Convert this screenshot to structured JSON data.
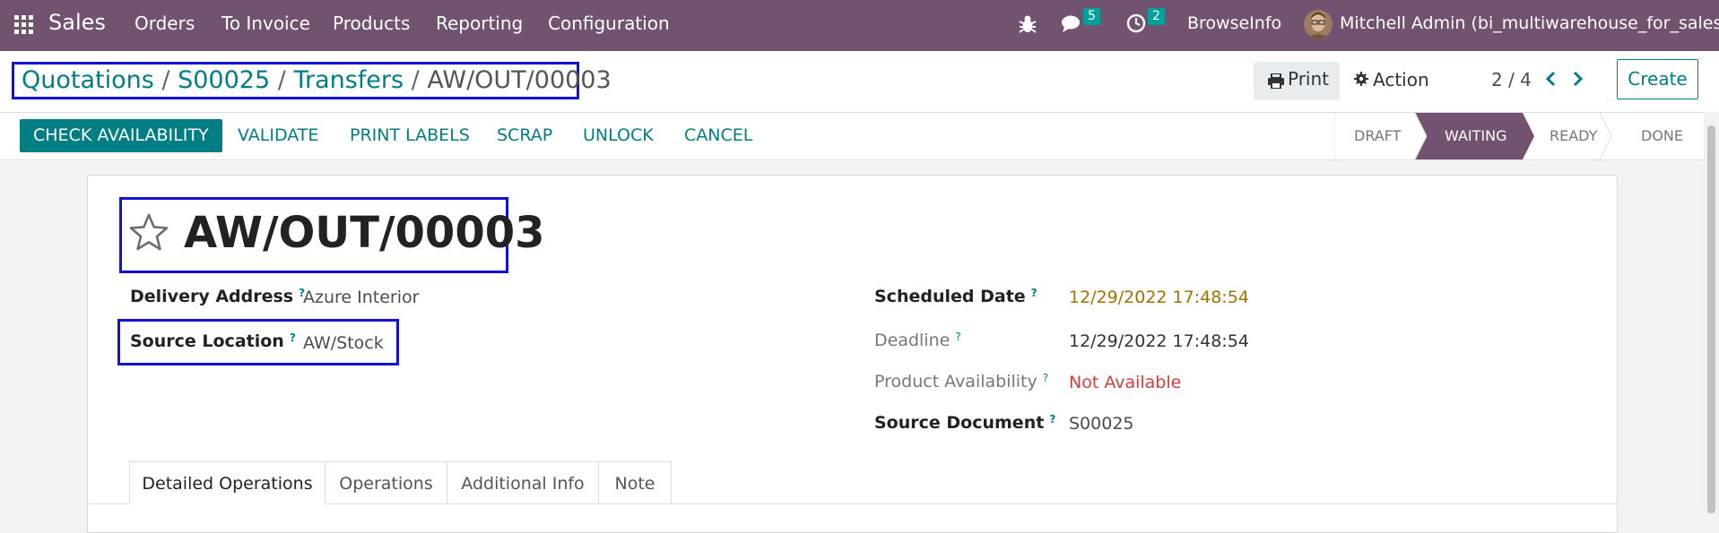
{
  "navbar": {
    "app_name": "Sales",
    "menu": [
      "Orders",
      "To Invoice",
      "Products",
      "Reporting",
      "Configuration"
    ],
    "messages_count": "5",
    "activities_count": "2",
    "company": "BrowseInfo",
    "user": "Mitchell Admin (bi_multiwarehouse_for_sales)"
  },
  "breadcrumb": {
    "items": [
      "Quotations",
      "S00025",
      "Transfers"
    ],
    "separator": "/",
    "current": "AW/OUT/00003"
  },
  "control": {
    "print_label": "Print",
    "action_label": "Action",
    "pager": "2 / 4",
    "create_label": "Create"
  },
  "statusbar": {
    "buttons": [
      "CHECK AVAILABILITY",
      "VALIDATE",
      "PRINT LABELS",
      "SCRAP",
      "UNLOCK",
      "CANCEL"
    ],
    "stages": [
      "DRAFT",
      "WAITING",
      "READY",
      "DONE"
    ],
    "active_stage": "WAITING"
  },
  "form": {
    "title": "AW/OUT/00003",
    "help_mark": "?",
    "delivery_address_label": "Delivery Address",
    "delivery_address": "Azure Interior",
    "source_location_label": "Source Location",
    "source_location": "AW/Stock",
    "scheduled_date_label": "Scheduled Date",
    "scheduled_date": "12/29/2022 17:48:54",
    "deadline_label": "Deadline",
    "deadline": "12/29/2022 17:48:54",
    "availability_label": "Product Availability",
    "availability": "Not Available",
    "source_document_label": "Source Document",
    "source_document": "S00025"
  },
  "tabs": [
    "Detailed Operations",
    "Operations",
    "Additional Info",
    "Note"
  ],
  "colors": {
    "navbar": "#71526f",
    "primary": "#017e84",
    "highlight_box": "#1212d9",
    "scheduled_date": "#a37100",
    "not_available": "#d23f3a",
    "badge": "#00a09d"
  }
}
